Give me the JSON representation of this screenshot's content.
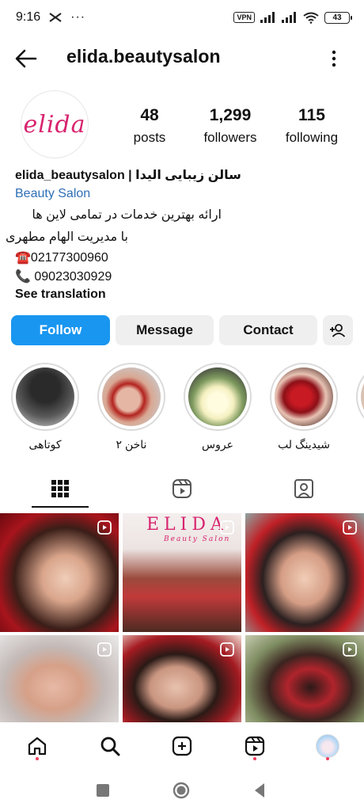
{
  "status_bar": {
    "time": "9:16",
    "vpn": "VPN",
    "battery": "43"
  },
  "header": {
    "title": "elida.beautysalon"
  },
  "profile": {
    "avatar_logo": "elida",
    "stats": {
      "posts_count": "48",
      "posts_label": "posts",
      "followers_count": "1,299",
      "followers_label": "followers",
      "following_count": "115",
      "following_label": "following"
    },
    "bio": {
      "name_line": "elida_beautysalon | سالن زیبایی الیدا",
      "category": "Beauty Salon",
      "line1": "ارائه بهترین خدمات در تمامی لاین ها",
      "line2": "با مدیریت الهام مطهری",
      "phone1": "☎️02177300960",
      "phone2": "📞 09023030929",
      "see_translation": "See translation"
    }
  },
  "actions": {
    "follow": "Follow",
    "message": "Message",
    "contact": "Contact"
  },
  "highlights": [
    {
      "label": "کوتاهی"
    },
    {
      "label": "ناخن ۲"
    },
    {
      "label": "عروس"
    },
    {
      "label": "شیدینگ لب"
    }
  ],
  "grid": {
    "post2_logo": "ELIDA",
    "post2_sub": "Beauty Salon"
  },
  "colors": {
    "accent_blue": "#1996f0",
    "link_blue": "#2e6fb5",
    "brand_pink": "#d8246f",
    "notification_red": "#ef3d5d"
  },
  "icons": {
    "back": "arrow-left-icon",
    "more": "vertical-dots-icon",
    "add_user": "add-user-icon",
    "tab_grid": "grid-icon",
    "tab_reels": "reels-icon",
    "tab_tagged": "tagged-icon",
    "nav_home": "home-icon",
    "nav_search": "search-icon",
    "nav_create": "plus-square-icon",
    "nav_reels": "reels-icon"
  }
}
